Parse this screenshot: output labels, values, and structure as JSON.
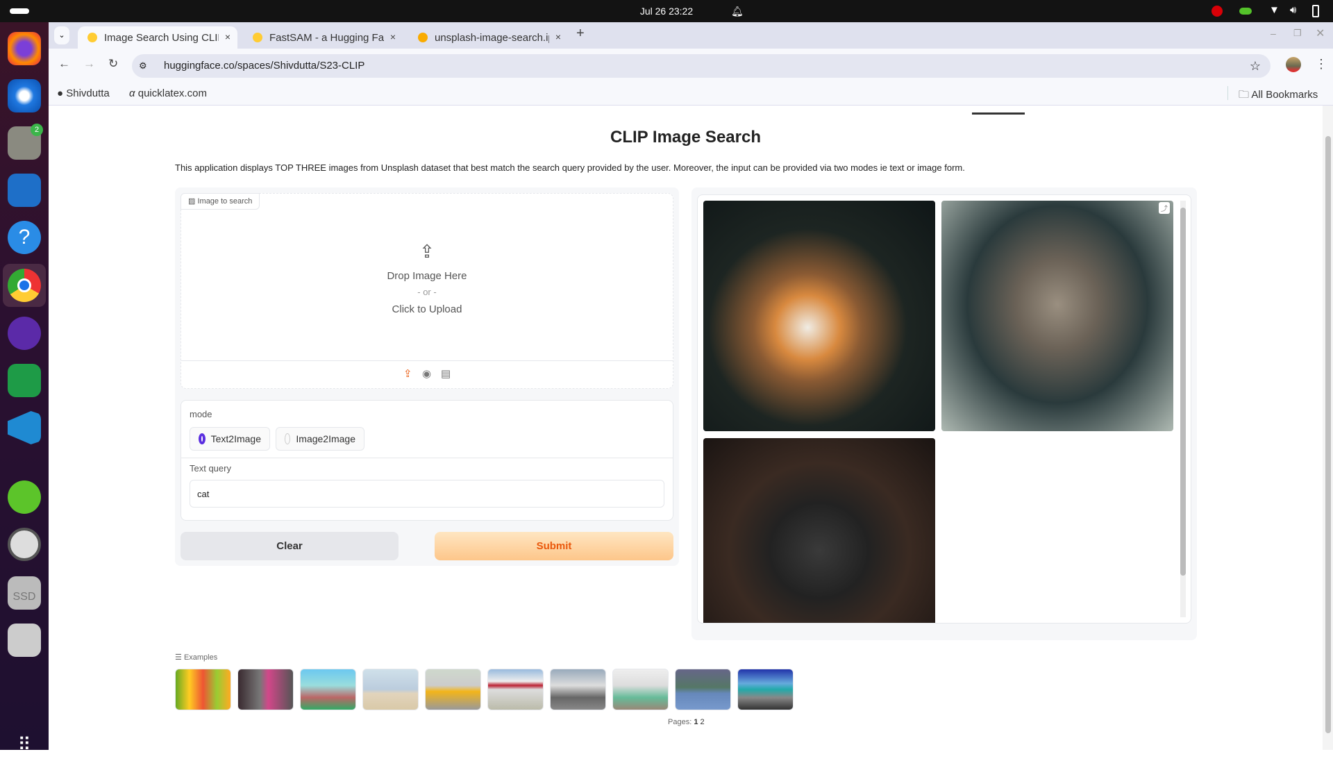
{
  "system": {
    "datetime": "Jul 26  23:22"
  },
  "browser": {
    "tabs": [
      {
        "label": "Image Search Using CLIP",
        "active": true
      },
      {
        "label": "FastSAM - a Hugging Face",
        "active": false
      },
      {
        "label": "unsplash-image-search.ipynb",
        "active": false
      }
    ],
    "url": "huggingface.co/spaces/Shivdutta/S23-CLIP",
    "bookmarks": [
      {
        "label": "Shivdutta",
        "icon": "github-icon"
      },
      {
        "label": "quicklatex.com",
        "icon": "alpha-icon"
      }
    ],
    "all_bookmarks": "All Bookmarks",
    "close_glyph": "×",
    "new_tab_glyph": "+"
  },
  "app": {
    "title": "CLIP Image Search",
    "description": "This application displays TOP THREE images from Unsplash dataset that best match the search query provided by the user. Moreover, the input can be provided via two modes ie text or image form.",
    "image_input": {
      "label": "Image to search",
      "drop": "Drop Image Here",
      "or": "- or -",
      "click": "Click to Upload"
    },
    "mode": {
      "label": "mode",
      "options": [
        "Text2Image",
        "Image2Image"
      ],
      "selected": "Text2Image"
    },
    "text_query": {
      "label": "Text query",
      "value": "cat"
    },
    "clear_label": "Clear",
    "submit_label": "Submit",
    "accent": "#ea580c",
    "examples": {
      "label": "Examples",
      "pages_label": "Pages:",
      "pages": [
        "1",
        "2"
      ]
    }
  },
  "dock": {
    "files_badge": "2"
  }
}
